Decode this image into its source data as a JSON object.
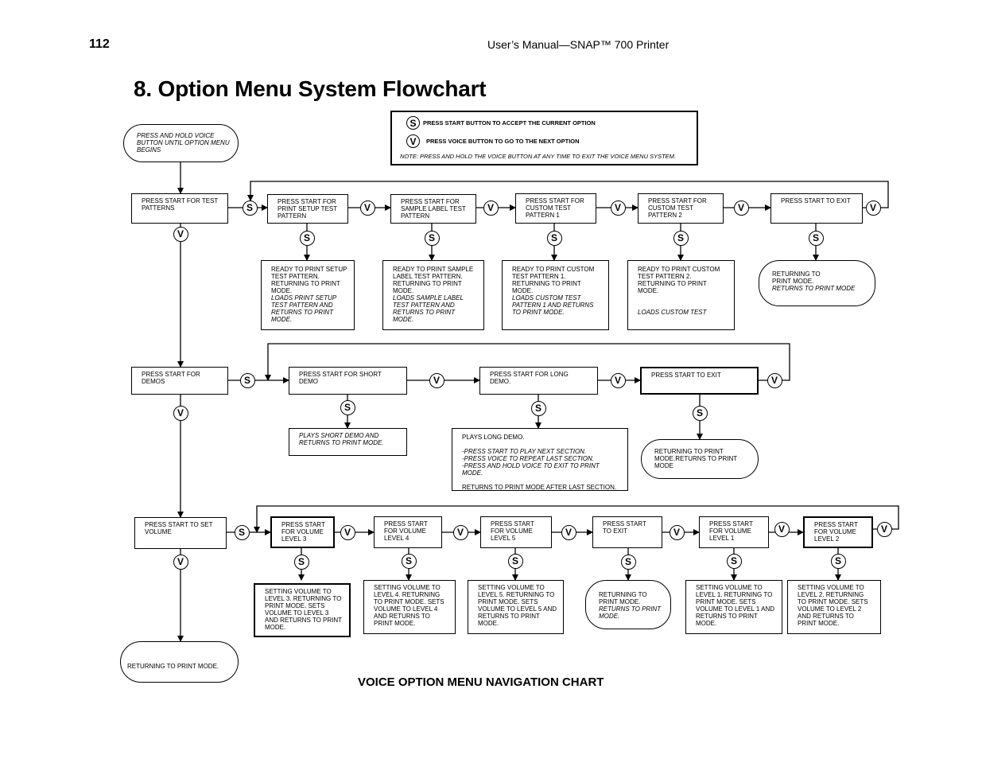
{
  "page": {
    "number": "112",
    "running_head": "User’s Manual—SNAP™ 700 Printer",
    "title": "8. Option Menu System Flowchart",
    "caption": "VOICE OPTION MENU NAVIGATION CHART"
  },
  "legend": {
    "start_symbol": "S",
    "start_text": "PRESS START BUTTON TO ACCEPT THE CURRENT OPTION",
    "voice_symbol": "V",
    "voice_text": "PRESS VOICE BUTTON TO GO TO THE NEXT OPTION",
    "note": "NOTE: PRESS AND HOLD THE VOICE BUTTON AT ANY TIME TO EXIT THE VOICE MENU SYSTEM."
  },
  "symbols": {
    "start": "S",
    "voice": "V"
  },
  "entry": {
    "text": "PRESS AND HOLD VOICE BUTTON UNTIL OPTION MENU BEGINS"
  },
  "test_patterns": {
    "menu": "PRESS START FOR TEST PATTERNS",
    "options": [
      {
        "label": "PRESS START FOR PRINT SETUP TEST PATTERN",
        "result": "READY TO PRINT SETUP TEST PATTERN. RETURNING TO PRINT MODE.",
        "result_italic": "LOADS PRINT SETUP TEST PATTERN AND RETURNS TO PRINT MODE."
      },
      {
        "label": "PRESS START FOR SAMPLE LABEL TEST PATTERN",
        "result": "READY TO PRINT SAMPLE LABEL TEST PATTERN. RETURNING TO PRINT MODE.",
        "result_italic": "LOADS SAMPLE LABEL TEST PATTERN AND RETURNS TO PRINT MODE."
      },
      {
        "label": "PRESS  START FOR CUSTOM TEST PATTERN 1",
        "result": "READY TO PRINT CUSTOM TEST PATTERN 1. RETURNING TO PRINT MODE.",
        "result_italic": "LOADS CUSTOM TEST PATTERN 1 AND RETURNS TO PRINT MODE."
      },
      {
        "label": "PRESS START FOR CUSTOM TEST PATTERN 2",
        "result": "READY TO PRINT CUSTOM TEST PATTERN 2. RETURNING TO PRINT MODE.",
        "result_italic": "LOADS CUSTOM TEST"
      },
      {
        "label": "PRESS START TO EXIT",
        "result": "RETURNING TO PRINT MODE.",
        "result_italic": "RETURNS TO PRINT MODE"
      }
    ]
  },
  "demos": {
    "menu": "PRESS START FOR DEMOS",
    "options": [
      {
        "label": "PRESS START FOR SHORT DEMO",
        "result_italic": "PLAYS SHORT DEMO AND RETURNS TO PRINT MODE."
      },
      {
        "label": "PRESS START FOR LONG DEMO.",
        "result_head": "PLAYS LONG DEMO.",
        "result_steps": [
          "-PRESS START TO PLAY NEXT SECTION.",
          "-PRESS VOICE TO REPEAT LAST SECTION.",
          "-PRESS AND HOLD VOICE TO EXIT TO PRINT MODE."
        ],
        "result_tail": "RETURNS TO PRINT MODE AFTER LAST SECTION."
      },
      {
        "label": "PRESS START TO EXIT",
        "result": "RETURNING TO PRINT MODE.RETURNS TO PRINT MODE"
      }
    ]
  },
  "volume": {
    "menu": "PRESS START TO SET VOLUME",
    "options": [
      {
        "label": "PRESS START FOR VOLUME LEVEL 3",
        "result": "SETTING VOLUME TO LEVEL 3. RETURNING TO PRINT MODE. SETS VOLUME TO LEVEL 3 AND RETURNS TO PRINT MODE."
      },
      {
        "label": "PRESS START FOR VOLUME LEVEL 4",
        "result": "SETTING VOLUME TO LEVEL 4. RETURNING TO PRINT MODE. SETS VOLUME TO LEVEL 4 AND RETURNS TO PRINT MODE."
      },
      {
        "label": "PRESS START FOR VOLUME LEVEL 5",
        "result": "SETTING VOLUME TO LEVEL 5. RETURNING TO PRINT MODE. SETS VOLUME TO LEVEL 5 AND RETURNS TO PRINT MODE."
      },
      {
        "label": "PRESS START TO EXIT",
        "result": "RETURNING TO PRINT MODE.",
        "result_italic": "RETURNS TO PRINT MODE."
      },
      {
        "label": "PRESS START FOR VOLUME LEVEL 1",
        "result": "SETTING VOLUME TO LEVEL 1. RETURNING TO PRINT MODE. SETS VOLUME TO LEVEL 1 AND RETURNS TO PRINT MODE."
      },
      {
        "label": "PRESS START FOR VOLUME LEVEL 2",
        "result": "SETTING VOLUME TO LEVEL 2. RETURNING TO PRINT MODE. SETS VOLUME TO LEVEL 2 AND RETURNS TO PRINT MODE."
      }
    ]
  },
  "final": {
    "text": "RETURNING TO PRINT MODE."
  }
}
